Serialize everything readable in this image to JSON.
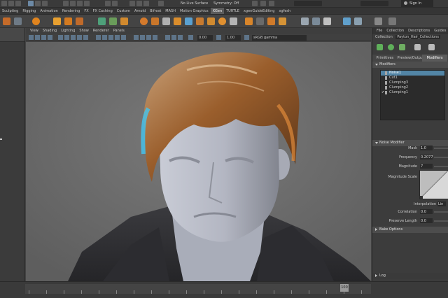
{
  "toolbar": {
    "live_surface": "No Live Surface",
    "symmetry": "Symmetry: Off",
    "sign_in": "Sign In"
  },
  "shelf_tabs": [
    "Sculpting",
    "Rigging",
    "Animation",
    "Rendering",
    "FX",
    "FX Caching",
    "Custom",
    "Arnold",
    "Bifrost",
    "MASH",
    "Motion Graphics",
    "XGen",
    "TURTLE",
    "xgenGuideEditing",
    "xgfesh"
  ],
  "viewport": {
    "menu": [
      "View",
      "Shading",
      "Lighting",
      "Show",
      "Renderer",
      "Panels"
    ],
    "value_a": "0.00",
    "value_b": "1.00",
    "color_space": "sRGB gamma"
  },
  "right_panel": {
    "tabs": [
      "File",
      "Collection",
      "Descriptions",
      "Guides"
    ],
    "collection_label": "Collection",
    "collection_value": "Payton_Hair_Collections",
    "subtabs": [
      "Primitives",
      "Preview/Output",
      "Modifiers"
    ],
    "modifiers_section": "Modifiers",
    "modifier_items": [
      {
        "label": "Noise1",
        "checked": false,
        "selected": true
      },
      {
        "label": "Cut1",
        "checked": false,
        "selected": false
      },
      {
        "label": "Clumping3",
        "checked": false,
        "selected": false
      },
      {
        "label": "Clumping2",
        "checked": false,
        "selected": false
      },
      {
        "label": "Clumping1",
        "checked": true,
        "selected": false
      }
    ],
    "noise_section": "Noise Modifier",
    "mask": {
      "label": "Mask",
      "value": "1.0"
    },
    "frequency": {
      "label": "Frequency",
      "value": "0.2077"
    },
    "magnitude": {
      "label": "Magnitude",
      "value": "7"
    },
    "magnitude_scale": "Magnitude Scale",
    "interpolation": "Interpolation",
    "interpolation_value": "Lin",
    "correlation": {
      "label": "Correlation",
      "value": "0.0"
    },
    "preserve_length": {
      "label": "Preserve Length",
      "value": "0.0"
    },
    "bake_options": "Bake Options",
    "log": "Log"
  },
  "timeline": {
    "current_frame": "100"
  }
}
